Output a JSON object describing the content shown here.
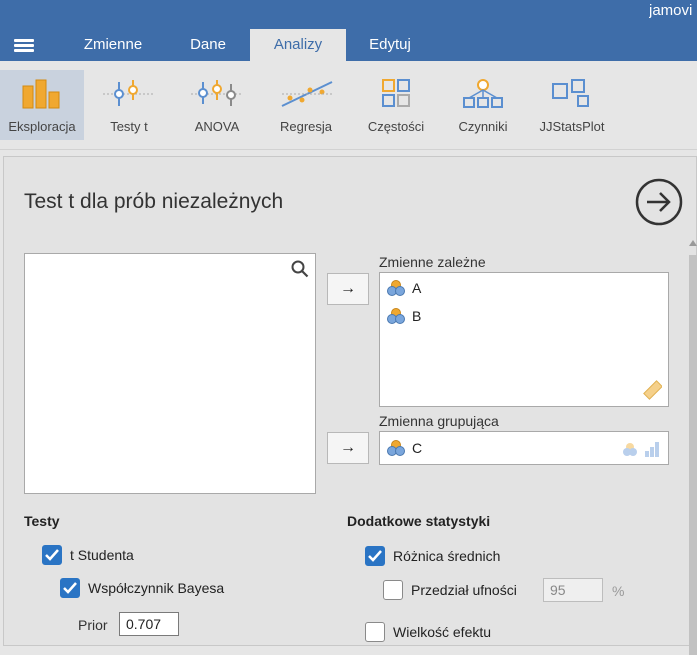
{
  "app": {
    "name": "jamovi"
  },
  "tabs": [
    {
      "label": "Zmienne",
      "active": false
    },
    {
      "label": "Dane",
      "active": false
    },
    {
      "label": "Analizy",
      "active": true
    },
    {
      "label": "Edytuj",
      "active": false
    }
  ],
  "ribbon": [
    {
      "label": "Eksploracja",
      "icon": "exploration-icon",
      "active": true
    },
    {
      "label": "Testy t",
      "icon": "t-test-icon",
      "active": false
    },
    {
      "label": "ANOVA",
      "icon": "anova-icon",
      "active": false
    },
    {
      "label": "Regresja",
      "icon": "regression-icon",
      "active": false
    },
    {
      "label": "Częstości",
      "icon": "frequencies-icon",
      "active": false
    },
    {
      "label": "Czynniki",
      "icon": "factor-icon",
      "active": false
    },
    {
      "label": "JJStatsPlot",
      "icon": "jjstatsplot-icon",
      "active": false
    }
  ],
  "analysis": {
    "title": "Test t dla prób niezależnych",
    "dependent_label": "Zmienne zależne",
    "dependent_vars": [
      "A",
      "B"
    ],
    "grouping_label": "Zmienna grupująca",
    "grouping_var": "C",
    "arrow": "→"
  },
  "tests": {
    "heading": "Testy",
    "student": {
      "label": "t Studenta",
      "checked": true
    },
    "bayes": {
      "label": "Współczynnik Bayesa",
      "checked": true
    },
    "prior_label": "Prior",
    "prior_value": "0.707"
  },
  "additional": {
    "heading": "Dodatkowe statystyki",
    "mean_diff": {
      "label": "Różnica średnich",
      "checked": true
    },
    "ci": {
      "label": "Przedział ufności",
      "checked": false,
      "value": "95",
      "unit": "%"
    },
    "effect_size": {
      "label": "Wielkość efektu",
      "checked": false
    }
  },
  "colors": {
    "accent": "#3e6da9",
    "checkbox": "#2a74c4",
    "icon_orange": "#f0a830",
    "icon_blue": "#5b8fd0"
  }
}
